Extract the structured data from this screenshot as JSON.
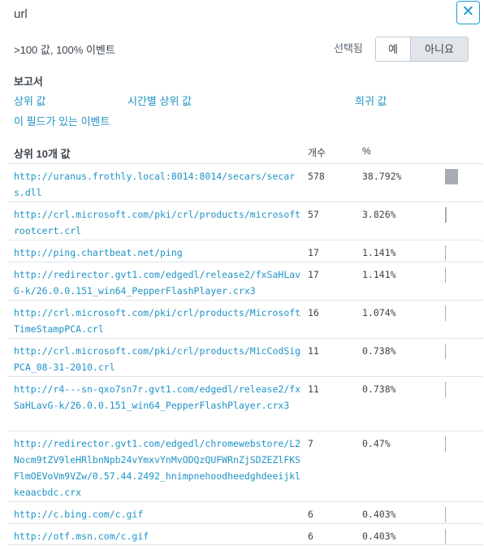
{
  "panel": {
    "title": "url",
    "close_icon": "close-icon"
  },
  "summary": {
    "text": ">100 값, 100% 이벤트",
    "selected_label": "선택됨",
    "yes_label": "예",
    "no_label": "아니요"
  },
  "reports": {
    "heading": "보고서",
    "links": {
      "top_values": "상위 값",
      "top_values_by_time": "시간별 상위 값",
      "rare_values": "희귀 값",
      "events_with_field": "이 필드가 있는 이벤트"
    }
  },
  "table": {
    "headers": {
      "value": "상위 10개 값",
      "count": "개수",
      "percent": "%"
    },
    "rows": [
      {
        "url": "http://uranus.frothly.local:8014:8014/secars/secars.dll",
        "count": "578",
        "percent": "38.792%",
        "fraction": 0.38792
      },
      {
        "url": "http://crl.microsoft.com/pki/crl/products/microsoftrootcert.crl",
        "count": "57",
        "percent": "3.826%",
        "fraction": 0.03826
      },
      {
        "url": "http://ping.chartbeat.net/ping",
        "count": "17",
        "percent": "1.141%",
        "fraction": 0.01141
      },
      {
        "url": "http://redirector.gvt1.com/edgedl/release2/fxSaHLavG-k/26.0.0.151_win64_PepperFlashPlayer.crx3",
        "count": "17",
        "percent": "1.141%",
        "fraction": 0.01141
      },
      {
        "url": "http://crl.microsoft.com/pki/crl/products/MicrosoftTimeStampPCA.crl",
        "count": "16",
        "percent": "1.074%",
        "fraction": 0.01074
      },
      {
        "url": "http://crl.microsoft.com/pki/crl/products/MicCodSigPCA_08-31-2010.crl",
        "count": "11",
        "percent": "0.738%",
        "fraction": 0.00738
      },
      {
        "url": "http://r4---sn-qxo7sn7r.gvt1.com/edgedl/release2/fxSaHLavG-k/26.0.0.151_win64_PepperFlashPlayer.crx3",
        "count": "11",
        "percent": "0.738%",
        "fraction": 0.00738
      },
      {
        "url": "http://redirector.gvt1.com/edgedl/chromewebstore/L2Nocm9tZV9leHRlbnNpb24vYmxvYnMvODQzQUFWRnZjSDZEZlFKSFlmOEVoVm9VZw/0.57.44.2492_hnimpnehoodheedghdeeijklkeaacbdc.crx",
        "count": "7",
        "percent": "0.47%",
        "fraction": 0.0047
      },
      {
        "url": "http://c.bing.com/c.gif",
        "count": "6",
        "percent": "0.403%",
        "fraction": 0.00403
      },
      {
        "url": "http://otf.msn.com/c.gif",
        "count": "6",
        "percent": "0.403%",
        "fraction": 0.00403
      }
    ]
  }
}
